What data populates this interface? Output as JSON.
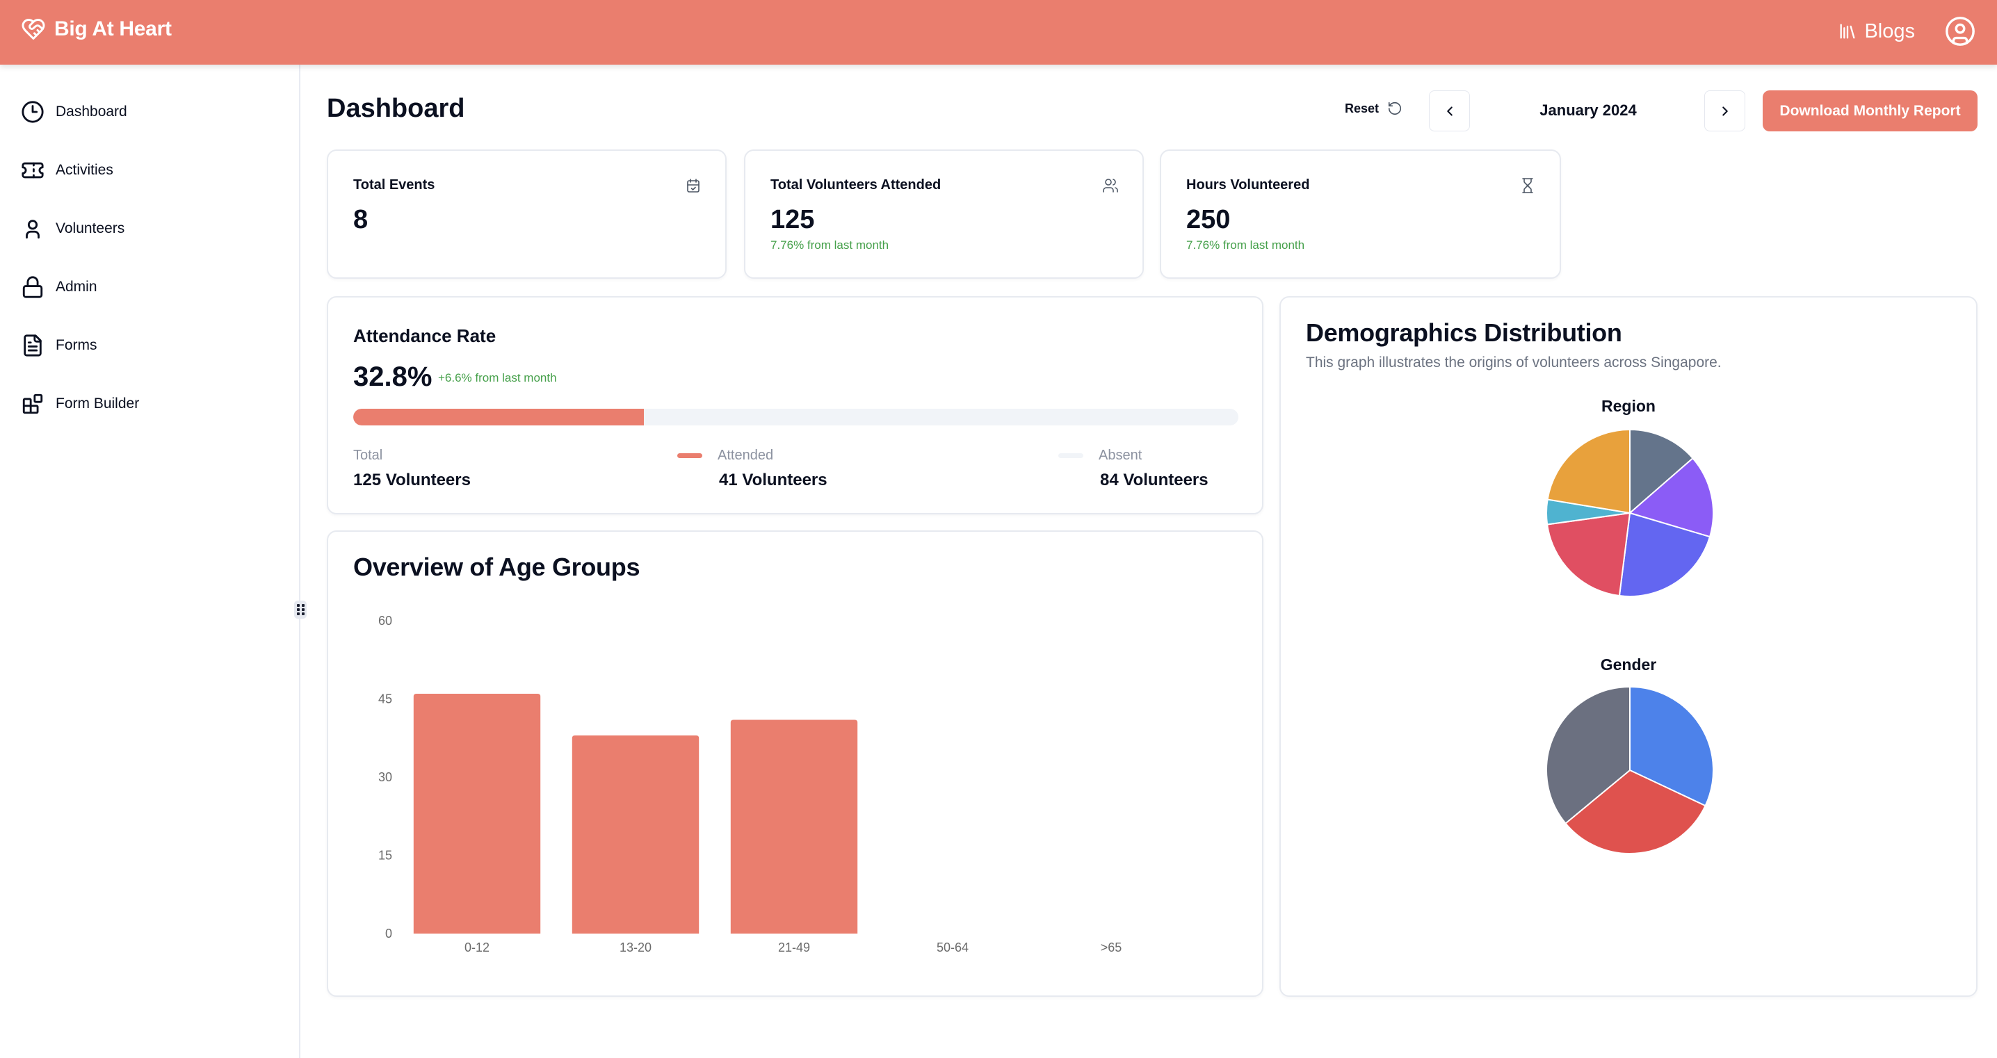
{
  "header": {
    "brand": "Big At Heart",
    "brand_icon": "heart-handshake-icon",
    "blogs_label": "Blogs",
    "blogs_icon": "library-icon",
    "profile_icon": "user-circle-icon",
    "accent_color": "#ea7e6e"
  },
  "sidebar": {
    "items": [
      {
        "label": "Dashboard",
        "icon": "clock-icon"
      },
      {
        "label": "Activities",
        "icon": "ticket-icon"
      },
      {
        "label": "Volunteers",
        "icon": "user-icon"
      },
      {
        "label": "Admin",
        "icon": "lock-icon"
      },
      {
        "label": "Forms",
        "icon": "file-text-icon"
      },
      {
        "label": "Form Builder",
        "icon": "blocks-icon"
      }
    ]
  },
  "toolbar": {
    "title": "Dashboard",
    "reset_label": "Reset",
    "month": "January 2024",
    "download_label": "Download Monthly Report"
  },
  "stats": [
    {
      "title": "Total Events",
      "value": "8",
      "delta": "",
      "icon": "calendar-check-icon"
    },
    {
      "title": "Total Volunteers Attended",
      "value": "125",
      "delta": "7.76% from last month",
      "icon": "users-icon"
    },
    {
      "title": "Hours Volunteered",
      "value": "250",
      "delta": "7.76% from last month",
      "icon": "hourglass-icon"
    }
  ],
  "attendance": {
    "title": "Attendance Rate",
    "rate": "32.8%",
    "rate_fraction": 0.328,
    "delta": "+6.6% from last month",
    "total_label": "Total",
    "total_value": "125 Volunteers",
    "attended_label": "Attended",
    "attended_value": "41 Volunteers",
    "absent_label": "Absent",
    "absent_value": "84 Volunteers",
    "attended_color": "#ea7e6e",
    "absent_color": "#f1f4f8"
  },
  "demographics": {
    "title": "Demographics Distribution",
    "subtitle": "This graph illustrates the origins of volunteers across Singapore."
  },
  "chart_data": [
    {
      "type": "bar",
      "title": "Overview of Age Groups",
      "categories": [
        "0-12",
        "13-20",
        "21-49",
        "50-64",
        ">65"
      ],
      "values": [
        46,
        38,
        41,
        0,
        0
      ],
      "yticks": [
        0,
        15,
        30,
        45,
        60
      ],
      "ylim": [
        0,
        60
      ],
      "xlabel": "",
      "ylabel": "",
      "grid": false,
      "color": "#ea7e6e"
    },
    {
      "type": "pie",
      "title": "Region",
      "labels": [
        "Slate",
        "Purple",
        "Indigo",
        "Red",
        "Cyan",
        "Orange"
      ],
      "values": [
        17,
        20,
        28,
        26,
        6,
        28
      ],
      "colors": [
        "#64748b",
        "#8b5cf6",
        "#6366f1",
        "#e04f62",
        "#4fb3d0",
        "#e8a13c"
      ],
      "legend": "none"
    },
    {
      "type": "pie",
      "title": "Gender",
      "labels": [
        "Blue",
        "Red",
        "Gray"
      ],
      "values": [
        40,
        40,
        45
      ],
      "colors": [
        "#4d82ea",
        "#df524e",
        "#6b7080"
      ],
      "legend": "none"
    }
  ]
}
